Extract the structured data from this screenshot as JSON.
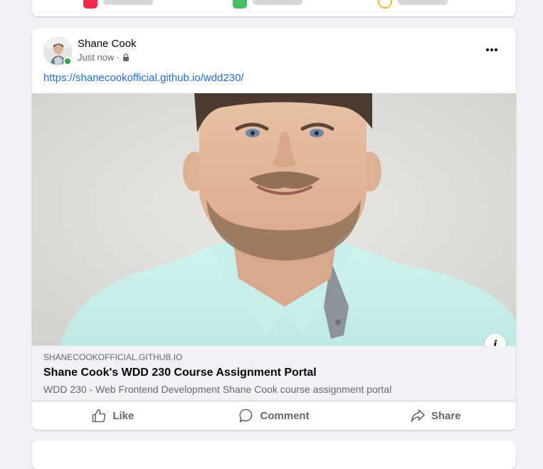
{
  "post": {
    "author_name": "Shane Cook",
    "timestamp": "Just now",
    "meta_separator": "·",
    "privacy_icon": "lock-icon",
    "link_url": "https://shanecookofficial.github.io/wdd230/",
    "more_icon": "more-options-icon",
    "online_status": "online",
    "preview": {
      "domain": "SHANECOOKOFFICIAL.GITHUB.IO",
      "title": "Shane Cook's WDD 230 Course Assignment Portal",
      "description": "WDD 230 - Web Frontend Development Shane Cook course assignment portal",
      "info_glyph": "i"
    },
    "actions": [
      {
        "label": "Like",
        "icon": "like-icon"
      },
      {
        "label": "Comment",
        "icon": "comment-icon"
      },
      {
        "label": "Share",
        "icon": "share-icon"
      }
    ]
  },
  "colors": {
    "link": "#216fdb",
    "secondary_text": "#65676b",
    "online": "#31a24c",
    "background": "#f0f2f5"
  }
}
